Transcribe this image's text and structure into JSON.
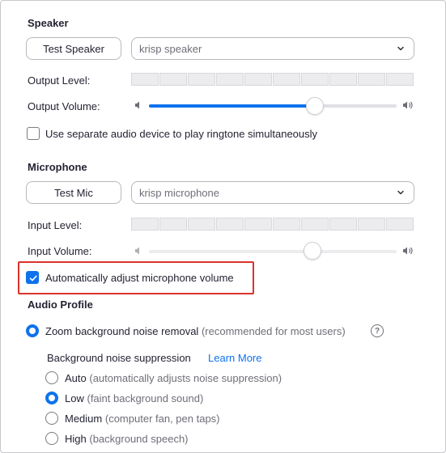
{
  "speaker": {
    "section_title": "Speaker",
    "test_button": "Test Speaker",
    "device_selected": "krisp speaker",
    "output_level_label": "Output Level:",
    "output_level_segments": 10,
    "output_volume_label": "Output Volume:",
    "output_volume_value": 0.67,
    "separate_ringtone_label": "Use separate audio device to play ringtone simultaneously",
    "separate_ringtone_checked": false
  },
  "microphone": {
    "section_title": "Microphone",
    "test_button": "Test Mic",
    "device_selected": "krisp microphone",
    "input_level_label": "Input Level:",
    "input_level_segments": 10,
    "input_volume_label": "Input Volume:",
    "input_volume_value": 0.66,
    "auto_adjust_label": "Automatically adjust microphone volume",
    "auto_adjust_checked": true
  },
  "audio_profile": {
    "section_title": "Audio Profile",
    "zoom_noise_removal_label": "Zoom background noise removal",
    "zoom_noise_removal_hint": "(recommended for most users)",
    "suppression_label": "Background noise suppression",
    "learn_more": "Learn More",
    "options": [
      {
        "label": "Auto",
        "hint": "(automatically adjusts noise suppression)",
        "selected": false
      },
      {
        "label": "Low",
        "hint": "(faint background sound)",
        "selected": true
      },
      {
        "label": "Medium",
        "hint": "(computer fan, pen taps)",
        "selected": false
      },
      {
        "label": "High",
        "hint": "(background speech)",
        "selected": false
      }
    ]
  },
  "colors": {
    "accent": "#0e72ed",
    "highlight_border": "#d9342b"
  },
  "icons": {
    "speaker_low": "volume-low-icon",
    "speaker_high": "volume-high-icon",
    "help": "help-icon",
    "chevron": "chevron-down-icon"
  }
}
